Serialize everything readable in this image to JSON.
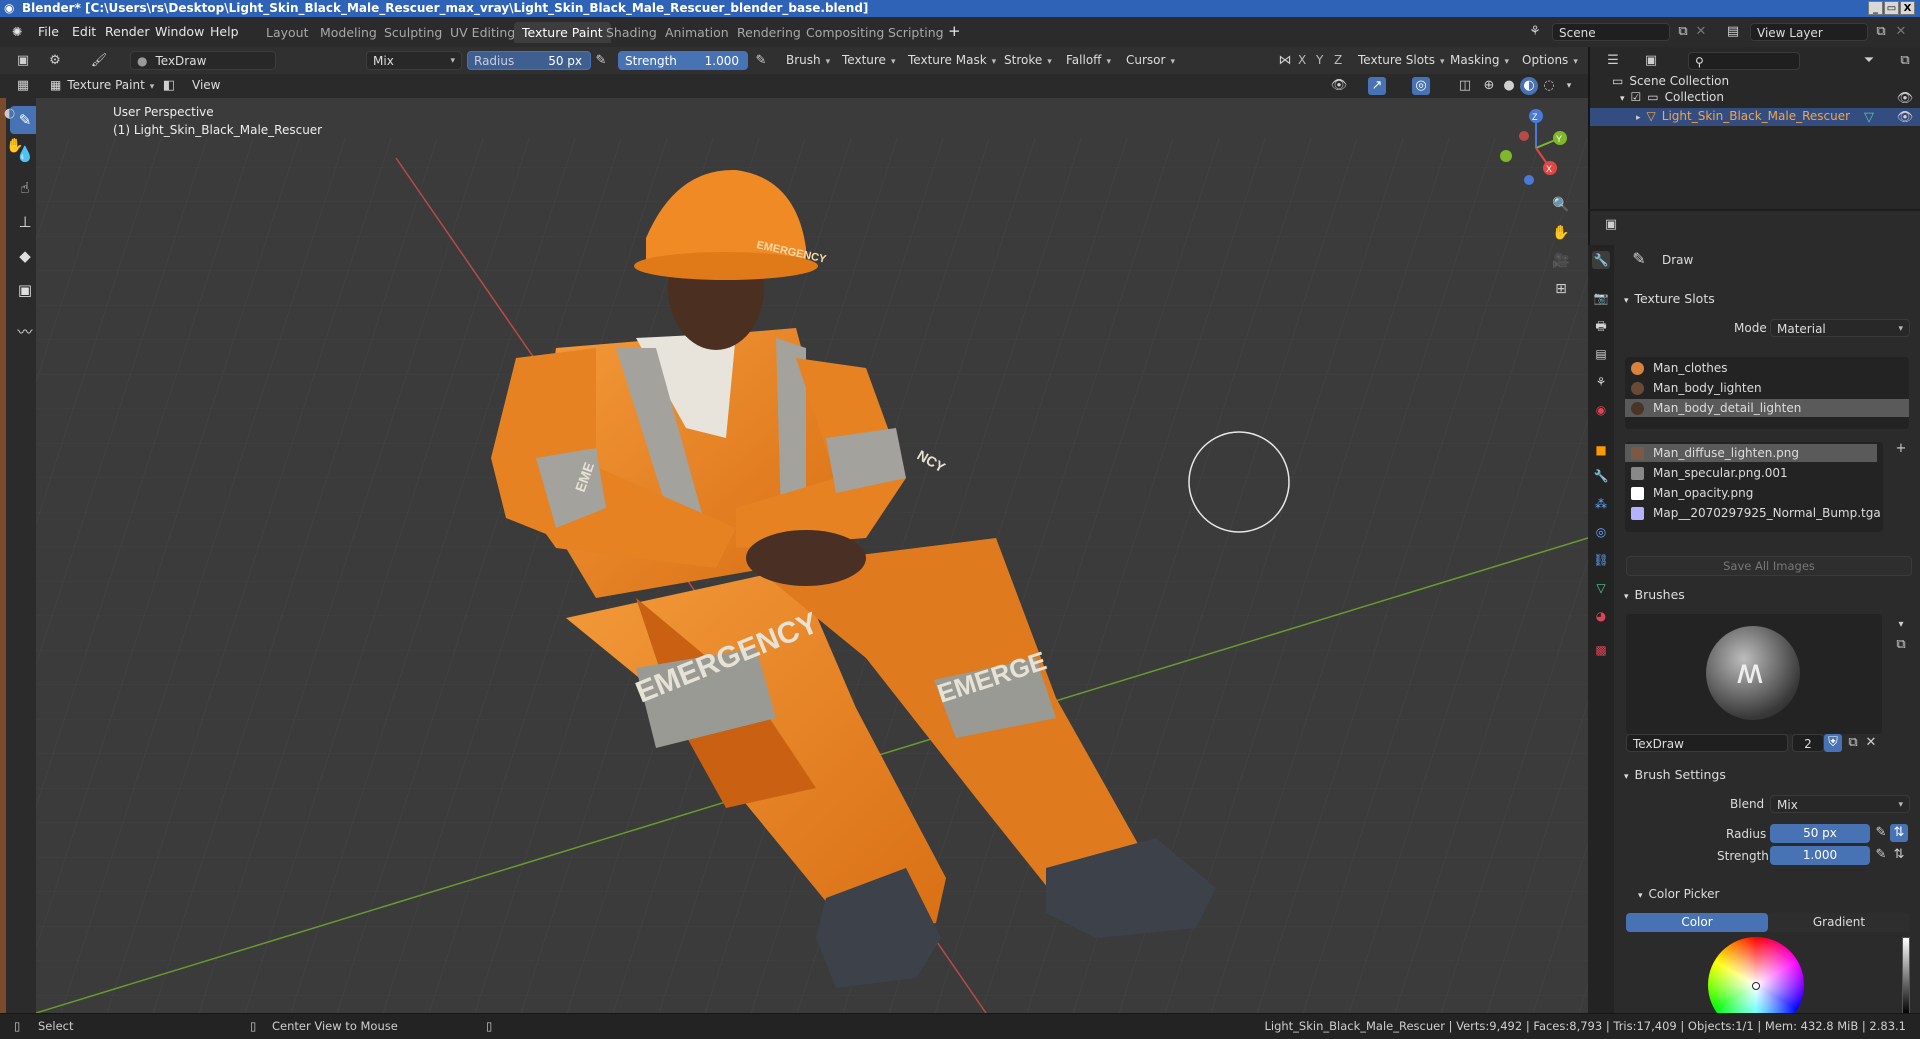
{
  "window": {
    "title": "Blender* [C:\\Users\\rs\\Desktop\\Light_Skin_Black_Male_Rescuer_max_vray\\Light_Skin_Black_Male_Rescuer_blender_base.blend]",
    "minimize": "_",
    "maximize": "▭",
    "close": "X"
  },
  "menu": [
    "File",
    "Edit",
    "Render",
    "Window",
    "Help"
  ],
  "workspaces": [
    "Layout",
    "Modeling",
    "Sculpting",
    "UV Editing",
    "Texture Paint",
    "Shading",
    "Animation",
    "Rendering",
    "Compositing",
    "Scripting"
  ],
  "active_workspace": "Texture Paint",
  "scene": {
    "label": "Scene",
    "view_layer": "View Layer"
  },
  "tool_header": {
    "brush_name": "TexDraw",
    "color": "#ffffff",
    "blend": "Mix",
    "radius_label": "Radius",
    "radius_value": "50 px",
    "strength_label": "Strength",
    "strength_value": "1.000",
    "menus": [
      "Brush",
      "Texture",
      "Texture Mask",
      "Stroke",
      "Falloff",
      "Cursor"
    ],
    "axes": [
      "X",
      "Y",
      "Z"
    ],
    "right_menus": [
      "Texture Slots",
      "Masking",
      "Options"
    ]
  },
  "mode_header": {
    "mode": "Texture Paint",
    "view": "View"
  },
  "viewport": {
    "perspective": "User Perspective",
    "object_label": "(1) Light_Skin_Black_Male_Rescuer",
    "helmet_text": "EMERGENCY",
    "leg_text_left": "EMERGENCY",
    "leg_text_right": "EMERGE",
    "sleeve_text_left": "EME",
    "sleeve_text_right": "NCY",
    "gizmo": {
      "x": "X",
      "y": "Y",
      "z": "Z"
    }
  },
  "outliner": {
    "root": "Scene Collection",
    "collection": "Collection",
    "object": "Light_Skin_Black_Male_Rescuer"
  },
  "properties": {
    "tool_name": "Draw",
    "texture_slots_title": "Texture Slots",
    "mode_label": "Mode",
    "mode_value": "Material",
    "materials": [
      {
        "name": "Man_clothes",
        "color": "#d9823a"
      },
      {
        "name": "Man_body_lighten",
        "color": "#6b4a35"
      },
      {
        "name": "Man_body_detail_lighten",
        "color": "#4a3426"
      }
    ],
    "images": [
      {
        "name": "Man_diffuse_lighten.png",
        "color": "#7a5a44"
      },
      {
        "name": "Man_specular.png.001",
        "color": "#888888"
      },
      {
        "name": "Man_opacity.png",
        "color": "#ffffff"
      },
      {
        "name": "Map__2070297925_Normal_Bump.tga",
        "color": "#b5b0ff"
      }
    ],
    "save_all": "Save All Images",
    "brushes_title": "Brushes",
    "brush_name": "TexDraw",
    "brush_users": "2",
    "brush_settings_title": "Brush Settings",
    "blend_label": "Blend",
    "blend_value": "Mix",
    "radius_label": "Radius",
    "radius_value": "50 px",
    "strength_label": "Strength",
    "strength_value": "1.000",
    "color_picker_title": "Color Picker",
    "color_tab": "Color",
    "gradient_tab": "Gradient"
  },
  "statusbar": {
    "select": "Select",
    "center_view": "Center View to Mouse",
    "stats": "Light_Skin_Black_Male_Rescuer | Verts:9,492 | Faces:8,793 | Tris:17,409 | Objects:1/1 | Mem: 432.8 MiB | 2.83.1"
  }
}
